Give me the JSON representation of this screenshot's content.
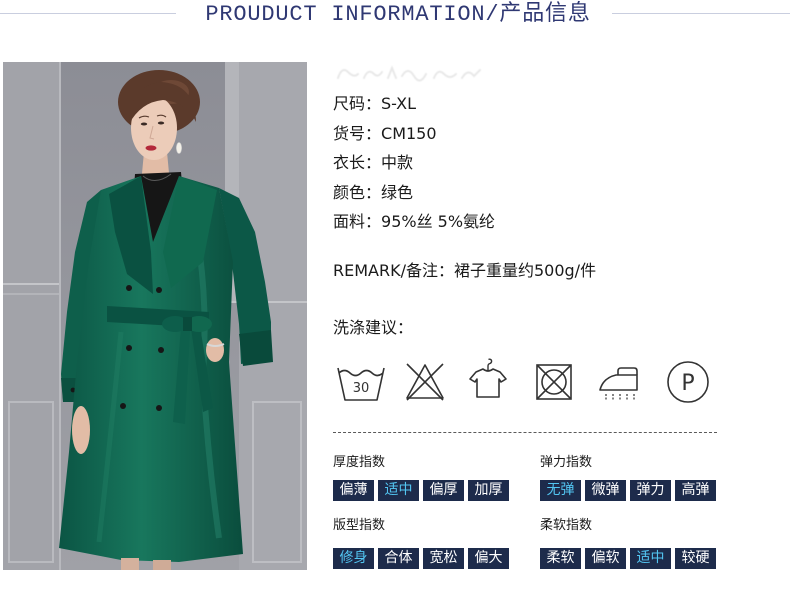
{
  "header": {
    "title": "PROUDUCT INFORMATION/产品信息"
  },
  "specs": [
    {
      "label": "尺码：",
      "value": "S-XL"
    },
    {
      "label": "货号：",
      "value": "CM150"
    },
    {
      "label": "衣长：",
      "value": "中款"
    },
    {
      "label": "颜色：",
      "value": "绿色"
    },
    {
      "label": "面料：",
      "value": "95%丝 5%氨纶"
    }
  ],
  "remark": {
    "label": "REMARK/备注：",
    "value": "裙子重量约500g/件"
  },
  "care": {
    "title": "洗涤建议：",
    "icons": [
      {
        "icon": "wash-30-icon",
        "label": "30"
      },
      {
        "icon": "no-bleach-icon"
      },
      {
        "icon": "hang-dry-icon"
      },
      {
        "icon": "no-tumble-dry-icon"
      },
      {
        "icon": "iron-icon"
      },
      {
        "icon": "dry-clean-p-icon",
        "label": "P"
      }
    ]
  },
  "indices": [
    {
      "title": "厚度指数",
      "options": [
        "偏薄",
        "适中",
        "偏厚",
        "加厚"
      ],
      "selected": 1
    },
    {
      "title": "弹力指数",
      "options": [
        "无弹",
        "微弹",
        "弹力",
        "高弹"
      ],
      "selected": 0
    },
    {
      "title": "版型指数",
      "options": [
        "修身",
        "合体",
        "宽松",
        "偏大"
      ],
      "selected": 0
    },
    {
      "title": "柔软指数",
      "options": [
        "柔软",
        "偏软",
        "适中",
        "较硬"
      ],
      "selected": 2
    }
  ],
  "colors": {
    "header_text": "#2f3873",
    "header_line": "#c9cedf",
    "body_text": "#1a1a1a",
    "option_bg": "#1d2b4b",
    "option_text": "#ffffff",
    "option_selected_text": "#53c6f2",
    "icon": "#333333",
    "coat_green": "#11664f"
  }
}
